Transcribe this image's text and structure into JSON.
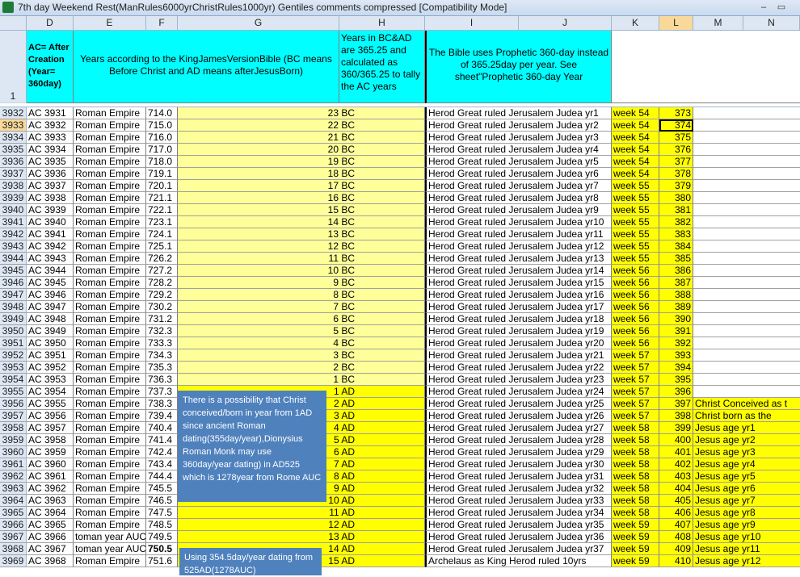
{
  "window": {
    "title": "7th day Weekend Rest(ManRules6000yrChristRules1000yr) Gentiles comments compressed  [Compatibility Mode]",
    "minimize_glyph": "–",
    "restore_glyph": "▭"
  },
  "columns": [
    "D",
    "E",
    "F",
    "G",
    "H",
    "I",
    "J",
    "K",
    "L",
    "M",
    "N"
  ],
  "selected_column": "L",
  "header_row": {
    "row_number": "1",
    "D": "AC= After Creation (Year= 360day)",
    "EF": "Years according to the KingJamesVersionBible (BC means Before Christ and AD means afterJesusBorn)",
    "H": "Years in BC&AD are 365.25 and calculated as 360/365.25 to tally the AC years",
    "IJ": "The Bible uses Prophetic 360-day instead of 365.25day per year. See sheet\"Prophetic 360-day Year"
  },
  "rows": [
    {
      "n": "3932",
      "d": "AC 3931",
      "e": "Roman Empire",
      "f": "714.0",
      "h": "23 BC",
      "i": "Herod Great ruled Jerusalem Judea yr1",
      "k": "week 54",
      "l": "373",
      "m": ""
    },
    {
      "n": "3933",
      "d": "AC 3932",
      "e": "Roman Empire",
      "f": "715.0",
      "h": "22 BC",
      "i": "Herod Great ruled Jerusalem Judea yr2",
      "k": "week 54",
      "l": "374",
      "m": ""
    },
    {
      "n": "3934",
      "d": "AC 3933",
      "e": "Roman Empire",
      "f": "716.0",
      "h": "21 BC",
      "i": "Herod Great ruled Jerusalem Judea yr3",
      "k": "week 54",
      "l": "375",
      "m": ""
    },
    {
      "n": "3935",
      "d": "AC 3934",
      "e": "Roman Empire",
      "f": "717.0",
      "h": "20 BC",
      "i": "Herod Great ruled Jerusalem Judea yr4",
      "k": "week 54",
      "l": "376",
      "m": ""
    },
    {
      "n": "3936",
      "d": "AC 3935",
      "e": "Roman Empire",
      "f": "718.0",
      "h": "19 BC",
      "i": "Herod Great ruled Jerusalem Judea yr5",
      "k": "week 54",
      "l": "377",
      "m": ""
    },
    {
      "n": "3937",
      "d": "AC 3936",
      "e": "Roman Empire",
      "f": "719.1",
      "h": "18 BC",
      "i": "Herod Great ruled Jerusalem Judea yr6",
      "k": "week 54",
      "l": "378",
      "m": ""
    },
    {
      "n": "3938",
      "d": "AC 3937",
      "e": "Roman Empire",
      "f": "720.1",
      "h": "17 BC",
      "i": "Herod Great ruled Jerusalem Judea yr7",
      "k": "week 55",
      "l": "379",
      "m": ""
    },
    {
      "n": "3939",
      "d": "AC 3938",
      "e": "Roman Empire",
      "f": "721.1",
      "h": "16 BC",
      "i": "Herod Great ruled Jerusalem Judea yr8",
      "k": "week 55",
      "l": "380",
      "m": ""
    },
    {
      "n": "3940",
      "d": "AC 3939",
      "e": "Roman Empire",
      "f": "722.1",
      "h": "15 BC",
      "i": "Herod Great ruled Jerusalem Judea yr9",
      "k": "week 55",
      "l": "381",
      "m": ""
    },
    {
      "n": "3941",
      "d": "AC 3940",
      "e": "Roman Empire",
      "f": "723.1",
      "h": "14 BC",
      "i": "Herod Great ruled Jerusalem Judea yr10",
      "k": "week 55",
      "l": "382",
      "m": ""
    },
    {
      "n": "3942",
      "d": "AC 3941",
      "e": "Roman Empire",
      "f": "724.1",
      "h": "13 BC",
      "i": "Herod Great ruled Jerusalem Judea yr11",
      "k": "week 55",
      "l": "383",
      "m": ""
    },
    {
      "n": "3943",
      "d": "AC 3942",
      "e": "Roman Empire",
      "f": "725.1",
      "h": "12 BC",
      "i": "Herod Great ruled Jerusalem Judea yr12",
      "k": "week 55",
      "l": "384",
      "m": ""
    },
    {
      "n": "3944",
      "d": "AC 3943",
      "e": "Roman Empire",
      "f": "726.2",
      "h": "11 BC",
      "i": "Herod Great ruled Jerusalem Judea yr13",
      "k": "week 55",
      "l": "385",
      "m": ""
    },
    {
      "n": "3945",
      "d": "AC 3944",
      "e": "Roman Empire",
      "f": "727.2",
      "h": "10 BC",
      "i": "Herod Great ruled Jerusalem Judea yr14",
      "k": "week 56",
      "l": "386",
      "m": ""
    },
    {
      "n": "3946",
      "d": "AC 3945",
      "e": "Roman Empire",
      "f": "728.2",
      "h": "9 BC",
      "i": "Herod Great ruled Jerusalem Judea yr15",
      "k": "week 56",
      "l": "387",
      "m": ""
    },
    {
      "n": "3947",
      "d": "AC 3946",
      "e": "Roman Empire",
      "f": "729.2",
      "h": "8 BC",
      "i": "Herod Great ruled Jerusalem Judea yr16",
      "k": "week 56",
      "l": "388",
      "m": ""
    },
    {
      "n": "3948",
      "d": "AC 3947",
      "e": "Roman Empire",
      "f": "730.2",
      "h": "7 BC",
      "i": "Herod Great ruled Jerusalem Judea yr17",
      "k": "week 56",
      "l": "389",
      "m": ""
    },
    {
      "n": "3949",
      "d": "AC 3948",
      "e": "Roman Empire",
      "f": "731.2",
      "h": "6 BC",
      "i": "Herod Great ruled Jerusalem Judea yr18",
      "k": "week 56",
      "l": "390",
      "m": ""
    },
    {
      "n": "3950",
      "d": "AC 3949",
      "e": "Roman Empire",
      "f": "732.3",
      "h": "5 BC",
      "i": "Herod Great ruled Jerusalem Judea yr19",
      "k": "week 56",
      "l": "391",
      "m": ""
    },
    {
      "n": "3951",
      "d": "AC 3950",
      "e": "Roman Empire",
      "f": "733.3",
      "h": "4 BC",
      "i": "Herod Great ruled Jerusalem Judea yr20",
      "k": "week 56",
      "l": "392",
      "m": ""
    },
    {
      "n": "3952",
      "d": "AC 3951",
      "e": "Roman Empire",
      "f": "734.3",
      "h": "3 BC",
      "i": "Herod Great ruled Jerusalem Judea yr21",
      "k": "week 57",
      "l": "393",
      "m": ""
    },
    {
      "n": "3953",
      "d": "AC 3952",
      "e": "Roman Empire",
      "f": "735.3",
      "h": "2 BC",
      "i": "Herod Great ruled Jerusalem Judea yr22",
      "k": "week 57",
      "l": "394",
      "m": ""
    },
    {
      "n": "3954",
      "d": "AC 3953",
      "e": "Roman Empire",
      "f": "736.3",
      "h": "1 BC",
      "i": "Herod Great ruled Jerusalem Judea yr23",
      "k": "week 57",
      "l": "395",
      "m": ""
    },
    {
      "n": "3955",
      "d": "AC 3954",
      "e": "Roman Empire",
      "f": "737.3",
      "h": "1 AD",
      "i": "Herod Great ruled Jerusalem Judea yr24",
      "k": "week 57",
      "l": "396",
      "m": ""
    },
    {
      "n": "3956",
      "d": "AC 3955",
      "e": "Roman Empire",
      "f": "738.3",
      "h": "2 AD",
      "i": "Herod Great ruled Jerusalem Judea yr25",
      "k": "week 57",
      "l": "397",
      "m": "  Christ Conceived as t"
    },
    {
      "n": "3957",
      "d": "AC 3956",
      "e": "Roman Empire",
      "f": "739.4",
      "h": "3 AD",
      "i": "Herod Great ruled Jerusalem Judea yr26",
      "k": "week 57",
      "l": "398",
      "m": "     Christ born as the"
    },
    {
      "n": "3958",
      "d": "AC 3957",
      "e": "Roman Empire",
      "f": "740.4",
      "h": "4 AD",
      "i": "Herod Great ruled Jerusalem Judea yr27",
      "k": "week 58",
      "l": "399",
      "m": "Jesus age yr1"
    },
    {
      "n": "3959",
      "d": "AC 3958",
      "e": "Roman Empire",
      "f": "741.4",
      "h": "5 AD",
      "i": "Herod Great ruled Jerusalem Judea yr28",
      "k": "week 58",
      "l": "400",
      "m": "Jesus age yr2"
    },
    {
      "n": "3960",
      "d": "AC 3959",
      "e": "Roman Empire",
      "f": "742.4",
      "h": "6 AD",
      "i": "Herod Great ruled Jerusalem Judea yr29",
      "k": "week 58",
      "l": "401",
      "m": "Jesus age yr3"
    },
    {
      "n": "3961",
      "d": "AC 3960",
      "e": "Roman Empire",
      "f": "743.4",
      "h": "7 AD",
      "i": "Herod Great ruled Jerusalem Judea yr30",
      "k": "week 58",
      "l": "402",
      "m": "Jesus age yr4"
    },
    {
      "n": "3962",
      "d": "AC 3961",
      "e": "Roman Empire",
      "f": "744.4",
      "h": "8 AD",
      "i": "Herod Great ruled Jerusalem Judea yr31",
      "k": "week 58",
      "l": "403",
      "m": "Jesus age yr5"
    },
    {
      "n": "3963",
      "d": "AC 3962",
      "e": "Roman Empire",
      "f": "745.5",
      "h": "9 AD",
      "i": "Herod Great ruled Jerusalem Judea yr32",
      "k": "week 58",
      "l": "404",
      "m": "Jesus age yr6"
    },
    {
      "n": "3964",
      "d": "AC 3963",
      "e": "Roman Empire",
      "f": "746.5",
      "h": "10 AD",
      "i": "Herod Great ruled Jerusalem Judea yr33",
      "k": "week 58",
      "l": "405",
      "m": "Jesus age yr7"
    },
    {
      "n": "3965",
      "d": "AC 3964",
      "e": "Roman Empire",
      "f": "747.5",
      "h": "11 AD",
      "i": "Herod Great ruled Jerusalem Judea yr34",
      "k": "week 58",
      "l": "406",
      "m": "Jesus age yr8"
    },
    {
      "n": "3966",
      "d": "AC 3965",
      "e": "Roman Empire",
      "f": "748.5",
      "h": "12 AD",
      "i": "Herod Great ruled Jerusalem Judea yr35",
      "k": "week 59",
      "l": "407",
      "m": "Jesus age yr9"
    },
    {
      "n": "3967",
      "d": "AC 3966",
      "e": "toman year AUC",
      "f": "749.5",
      "h": "13 AD",
      "i": "Herod Great ruled Jerusalem Judea yr36",
      "k": "week 59",
      "l": "408",
      "m": "Jesus age yr10"
    },
    {
      "n": "3968",
      "d": "AC 3967",
      "e": "toman year AUC",
      "f": "750.5",
      "h": "14 AD",
      "i": "Herod Great ruled Jerusalem Judea yr37",
      "k": "week 59",
      "l": "409",
      "m": "Jesus age yr11"
    },
    {
      "n": "3969",
      "d": "AC 3968",
      "e": "Roman Empire",
      "f": "751.6",
      "h": "15 AD",
      "i": "Archelaus as King Herod ruled 10yrs",
      "k": "week 59",
      "l": "410",
      "m": "Jesus age yr12"
    }
  ],
  "notes": {
    "note1": "There is a possibility that Christ conceived/born in year from 1AD since ancient Roman dating(355day/year),Dionysius Roman Monk may use 360day/year dating) in AD525 which is 1278year from Rome AUC",
    "note2": "Using 354.5day/year dating from 525AD(1278AUC)"
  },
  "colors": {
    "header_cyan": "#00ffff",
    "highlight_yellow": "#ffff00",
    "light_yellow": "#ffff99",
    "note_blue": "#4f81bd"
  }
}
